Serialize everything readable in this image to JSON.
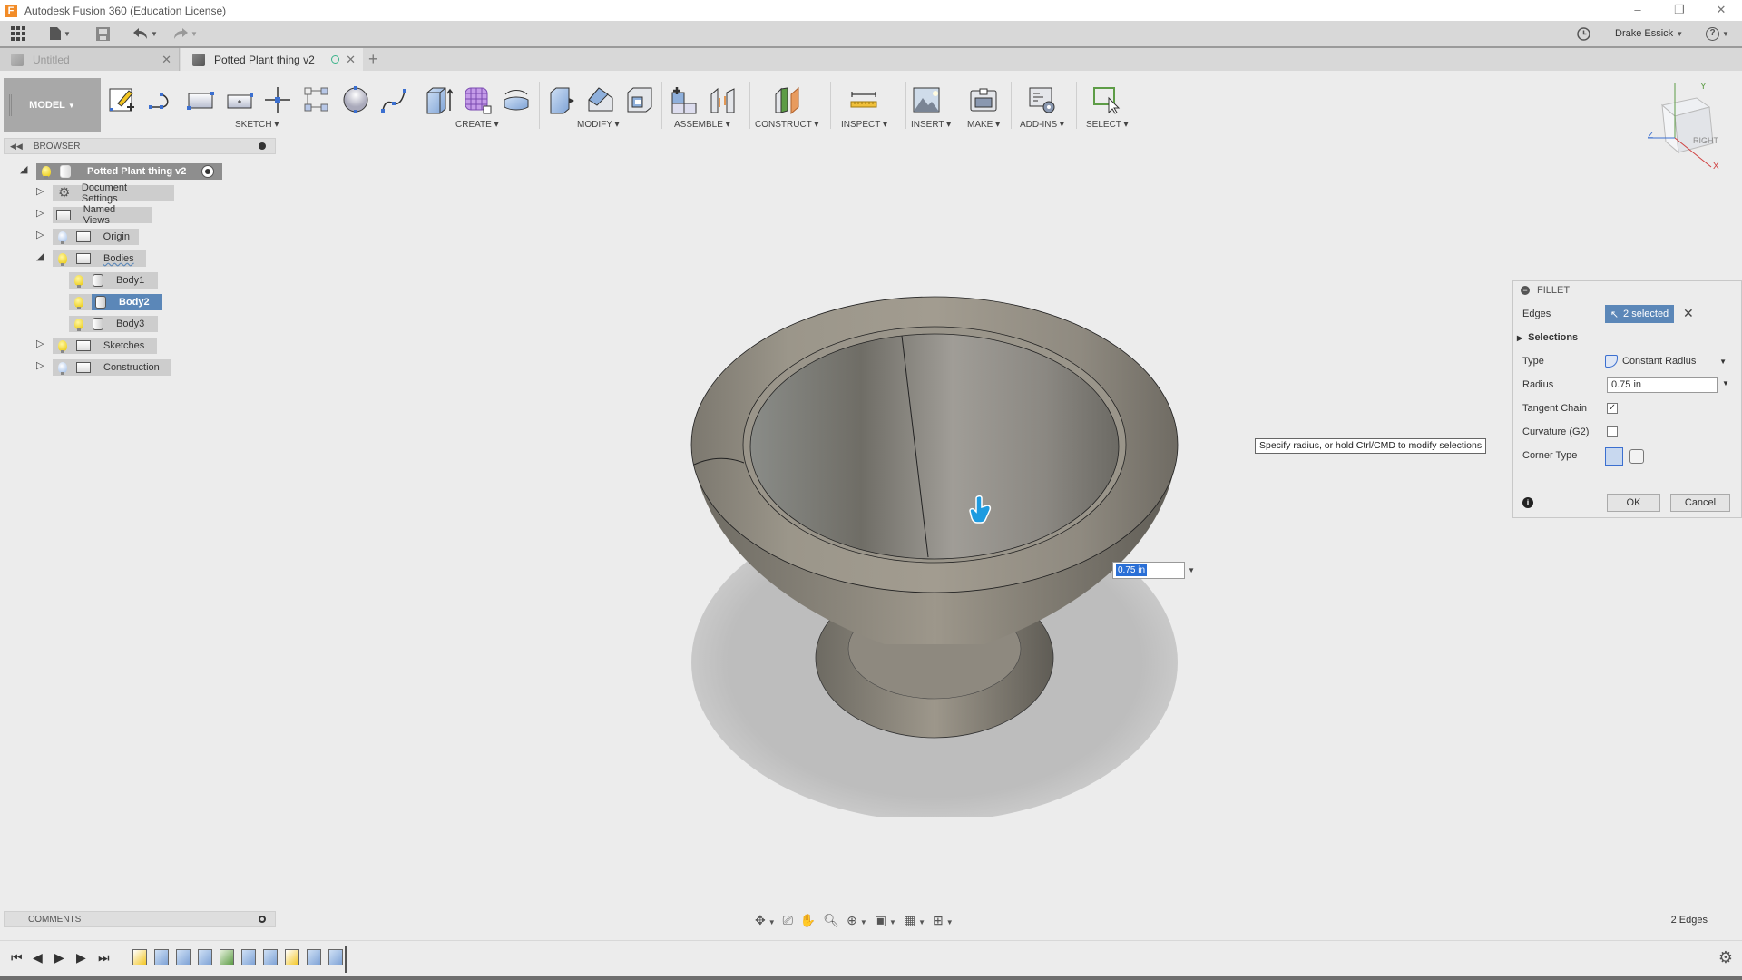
{
  "window": {
    "title": "Autodesk Fusion 360 (Education License)",
    "app_logo_letter": "F",
    "controls": {
      "minimize": "–",
      "restore": "❐",
      "close": "✕"
    }
  },
  "quick_access": {
    "items": [
      {
        "name": "data-panel",
        "icon": "grid-icon"
      },
      {
        "name": "file-menu",
        "icon": "file-icon"
      },
      {
        "name": "save",
        "icon": "save-icon"
      },
      {
        "name": "undo",
        "icon": "undo-icon"
      },
      {
        "name": "redo",
        "icon": "redo-icon"
      }
    ],
    "user_name": "Drake Essick",
    "help_label": "?"
  },
  "tabs": [
    {
      "label": "Untitled",
      "active": false
    },
    {
      "label": "Potted Plant thing v2",
      "active": true
    }
  ],
  "toolbar": {
    "workspace": "MODEL",
    "groups": [
      {
        "label": "SKETCH",
        "tools": [
          "create-sketch",
          "arc",
          "rectangle",
          "center-rectangle",
          "point",
          "pattern",
          "circle",
          "spline"
        ]
      },
      {
        "label": "CREATE",
        "tools": [
          "extrude",
          "form",
          "revolve"
        ]
      },
      {
        "label": "MODIFY",
        "tools": [
          "press-pull",
          "fillet",
          "shell"
        ]
      },
      {
        "label": "ASSEMBLE",
        "tools": [
          "new-component",
          "joint"
        ]
      },
      {
        "label": "CONSTRUCT",
        "tools": [
          "offset-plane"
        ]
      },
      {
        "label": "INSPECT",
        "tools": [
          "measure"
        ]
      },
      {
        "label": "INSERT",
        "tools": [
          "insert-image"
        ]
      },
      {
        "label": "MAKE",
        "tools": [
          "3d-print"
        ]
      },
      {
        "label": "ADD-INS",
        "tools": [
          "scripts"
        ]
      },
      {
        "label": "SELECT",
        "tools": [
          "select"
        ]
      }
    ]
  },
  "browser": {
    "title": "BROWSER",
    "root": "Potted Plant thing v2",
    "items": [
      {
        "label": "Document Settings",
        "icon": "gear-icon",
        "expanded": false,
        "level": 1
      },
      {
        "label": "Named Views",
        "icon": "folder-icon",
        "expanded": false,
        "level": 1
      },
      {
        "label": "Origin",
        "icon": "folder-icon",
        "expanded": false,
        "level": 1,
        "visible": false
      },
      {
        "label": "Bodies",
        "icon": "folder-icon",
        "expanded": true,
        "level": 1,
        "visible": true
      },
      {
        "label": "Body1",
        "icon": "body-icon",
        "level": 2,
        "visible": true
      },
      {
        "label": "Body2",
        "icon": "body-icon",
        "level": 2,
        "visible": true,
        "selected": true
      },
      {
        "label": "Body3",
        "icon": "body-icon",
        "level": 2,
        "visible": true
      },
      {
        "label": "Sketches",
        "icon": "folder-icon",
        "expanded": false,
        "level": 1,
        "visible": true
      },
      {
        "label": "Construction",
        "icon": "folder-icon",
        "expanded": false,
        "level": 1,
        "visible": false
      }
    ]
  },
  "viewcube": {
    "face": "RIGHT",
    "axes": {
      "x": "X",
      "y": "Y",
      "z": "Z"
    }
  },
  "fillet": {
    "title": "FILLET",
    "edges_label": "Edges",
    "edges_value": "2 selected",
    "selections_label": "Selections",
    "type_label": "Type",
    "type_value": "Constant Radius",
    "radius_label": "Radius",
    "radius_value": "0.75 in",
    "tangent_chain_label": "Tangent Chain",
    "tangent_chain_checked": true,
    "curvature_label": "Curvature (G2)",
    "curvature_checked": false,
    "corner_type_label": "Corner Type",
    "ok_label": "OK",
    "cancel_label": "Cancel"
  },
  "tooltip": "Specify radius, or hold Ctrl/CMD to modify selections",
  "inline_radius": "0.75 in",
  "comments": {
    "title": "COMMENTS"
  },
  "status": {
    "selection": "2 Edges"
  },
  "colors": {
    "accent": "#5b87b8",
    "model_body": "#8f8a80",
    "shadow": "#c4c4c4",
    "selection_blue": "#2a6fd6"
  }
}
